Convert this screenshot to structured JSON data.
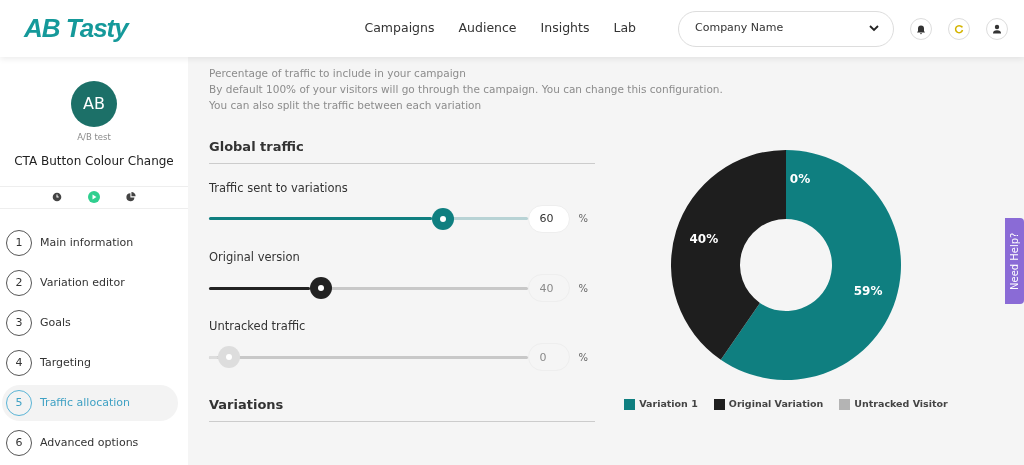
{
  "header": {
    "logo": "AB Tasty",
    "nav": [
      {
        "label": "Campaigns"
      },
      {
        "label": "Audience"
      },
      {
        "label": "Insights"
      },
      {
        "label": "Lab"
      }
    ],
    "account_select": {
      "value": "Company Name"
    },
    "icons": [
      {
        "kind": "bell"
      },
      {
        "kind": "refresh"
      },
      {
        "kind": "user"
      }
    ]
  },
  "sidebar": {
    "avatar": "AB",
    "campaign_type": "A/B test",
    "campaign_name": "CTA Button Colour Change",
    "status_icons": [
      {
        "kind": "clock",
        "selected": false
      },
      {
        "kind": "play",
        "selected": true
      },
      {
        "kind": "pie",
        "selected": false
      }
    ],
    "steps": [
      {
        "number": "1",
        "label": "Main information",
        "selected": false
      },
      {
        "number": "2",
        "label": "Variation editor",
        "selected": false
      },
      {
        "number": "3",
        "label": "Goals",
        "selected": false
      },
      {
        "number": "4",
        "label": "Targeting",
        "selected": false
      },
      {
        "number": "5",
        "label": "Traffic allocation",
        "selected": true
      },
      {
        "number": "6",
        "label": "Advanced options",
        "selected": false
      }
    ]
  },
  "intro": [
    "Percentage of traffic to include in your campaign",
    "By default 100% of your visitors will go through the campaign. You can change this configuration.",
    "You can also split the traffic between each variation"
  ],
  "global_traffic": {
    "title": "Global traffic",
    "sliders": [
      {
        "label": "Traffic sent to variations",
        "level": 0.75,
        "value": "60",
        "unit": "%",
        "color": "#0f7f80",
        "disabled": false
      },
      {
        "label": "Original version",
        "level": 0.34,
        "value": "40",
        "unit": "%",
        "color": "#222222",
        "disabled": true
      },
      {
        "label": "Untracked traffic",
        "level": 0.03,
        "value": "0",
        "unit": "%",
        "color": "#dddddd",
        "disabled": true
      }
    ]
  },
  "variations": {
    "title": "Variations"
  },
  "chart_data": {
    "type": "donut",
    "categories": [
      "Variation 1",
      "Original Variation",
      "Untracked Visitor"
    ],
    "values": [
      59,
      40,
      0
    ],
    "value_labels": [
      "59%",
      "40%",
      "0%"
    ],
    "colors": [
      "#0f7f80",
      "#1e1e1e",
      "#b4b4b4"
    ],
    "data_labels": true
  },
  "help_tab": "Need Help?"
}
